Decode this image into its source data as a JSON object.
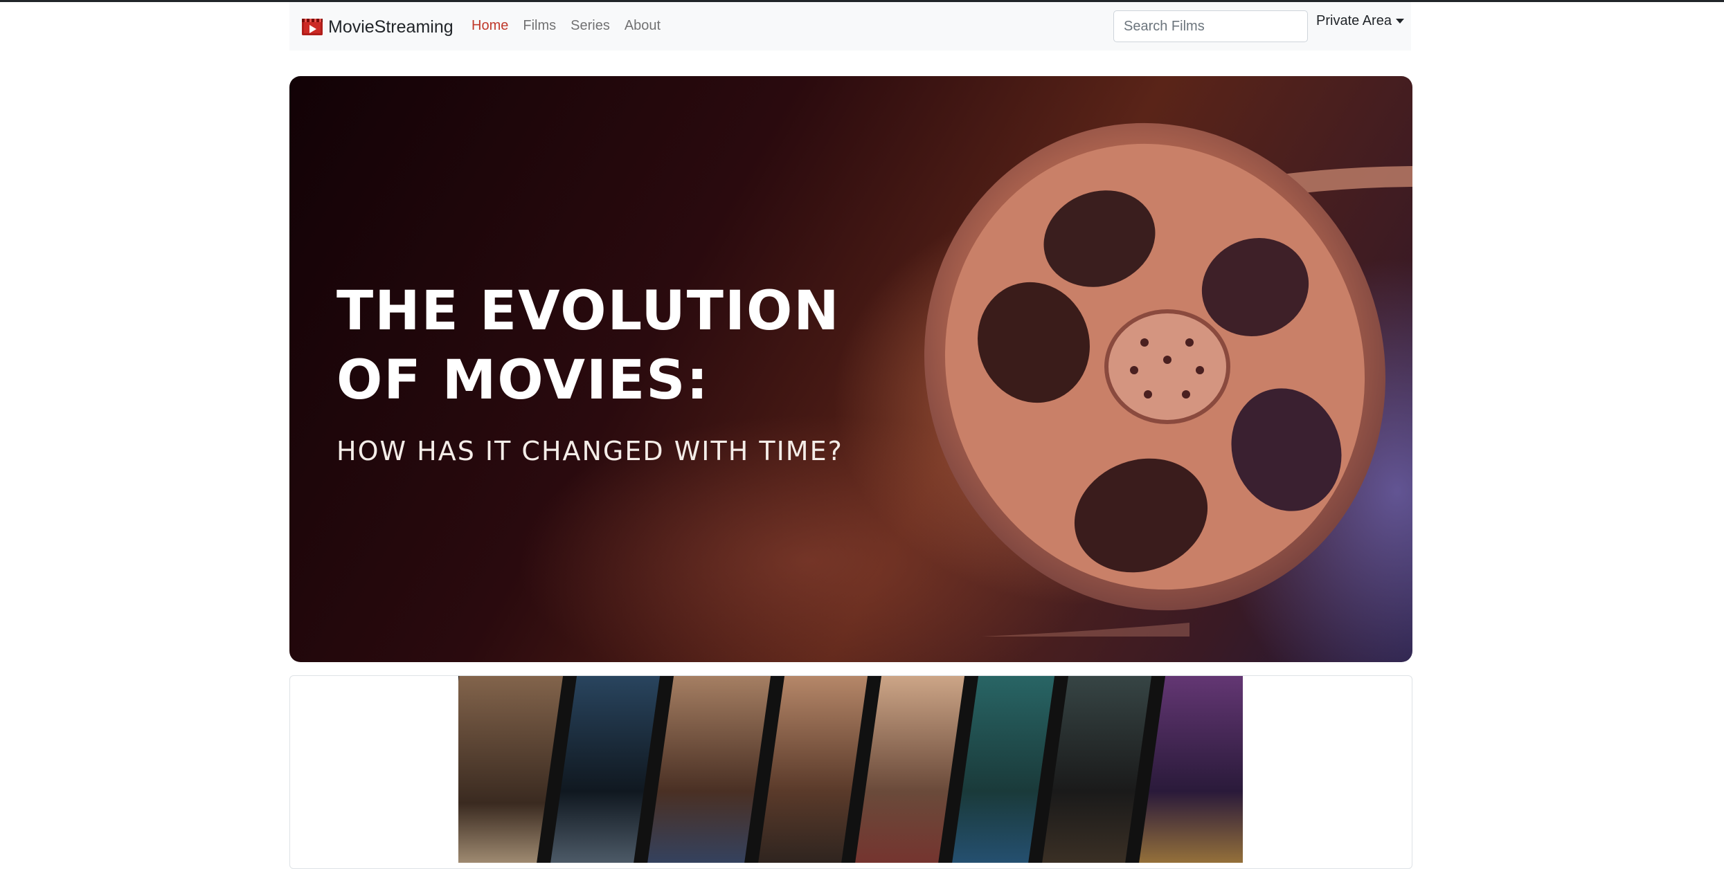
{
  "navbar": {
    "brand": "MovieStreaming",
    "brand_icon": "movie-play-icon",
    "links": [
      {
        "label": "Home",
        "active": true
      },
      {
        "label": "Films",
        "active": false
      },
      {
        "label": "Series",
        "active": false
      },
      {
        "label": "About",
        "active": false
      }
    ],
    "search_placeholder": "Search Films",
    "private_area": "Private Area"
  },
  "hero": {
    "title_line1": "THE EVOLUTION",
    "title_line2": "OF MOVIES:",
    "subtitle": "HOW HAS IT CHANGED WITH TIME?"
  },
  "colors": {
    "accent": "#c0392b",
    "navbar_bg": "#f8f9fa"
  }
}
